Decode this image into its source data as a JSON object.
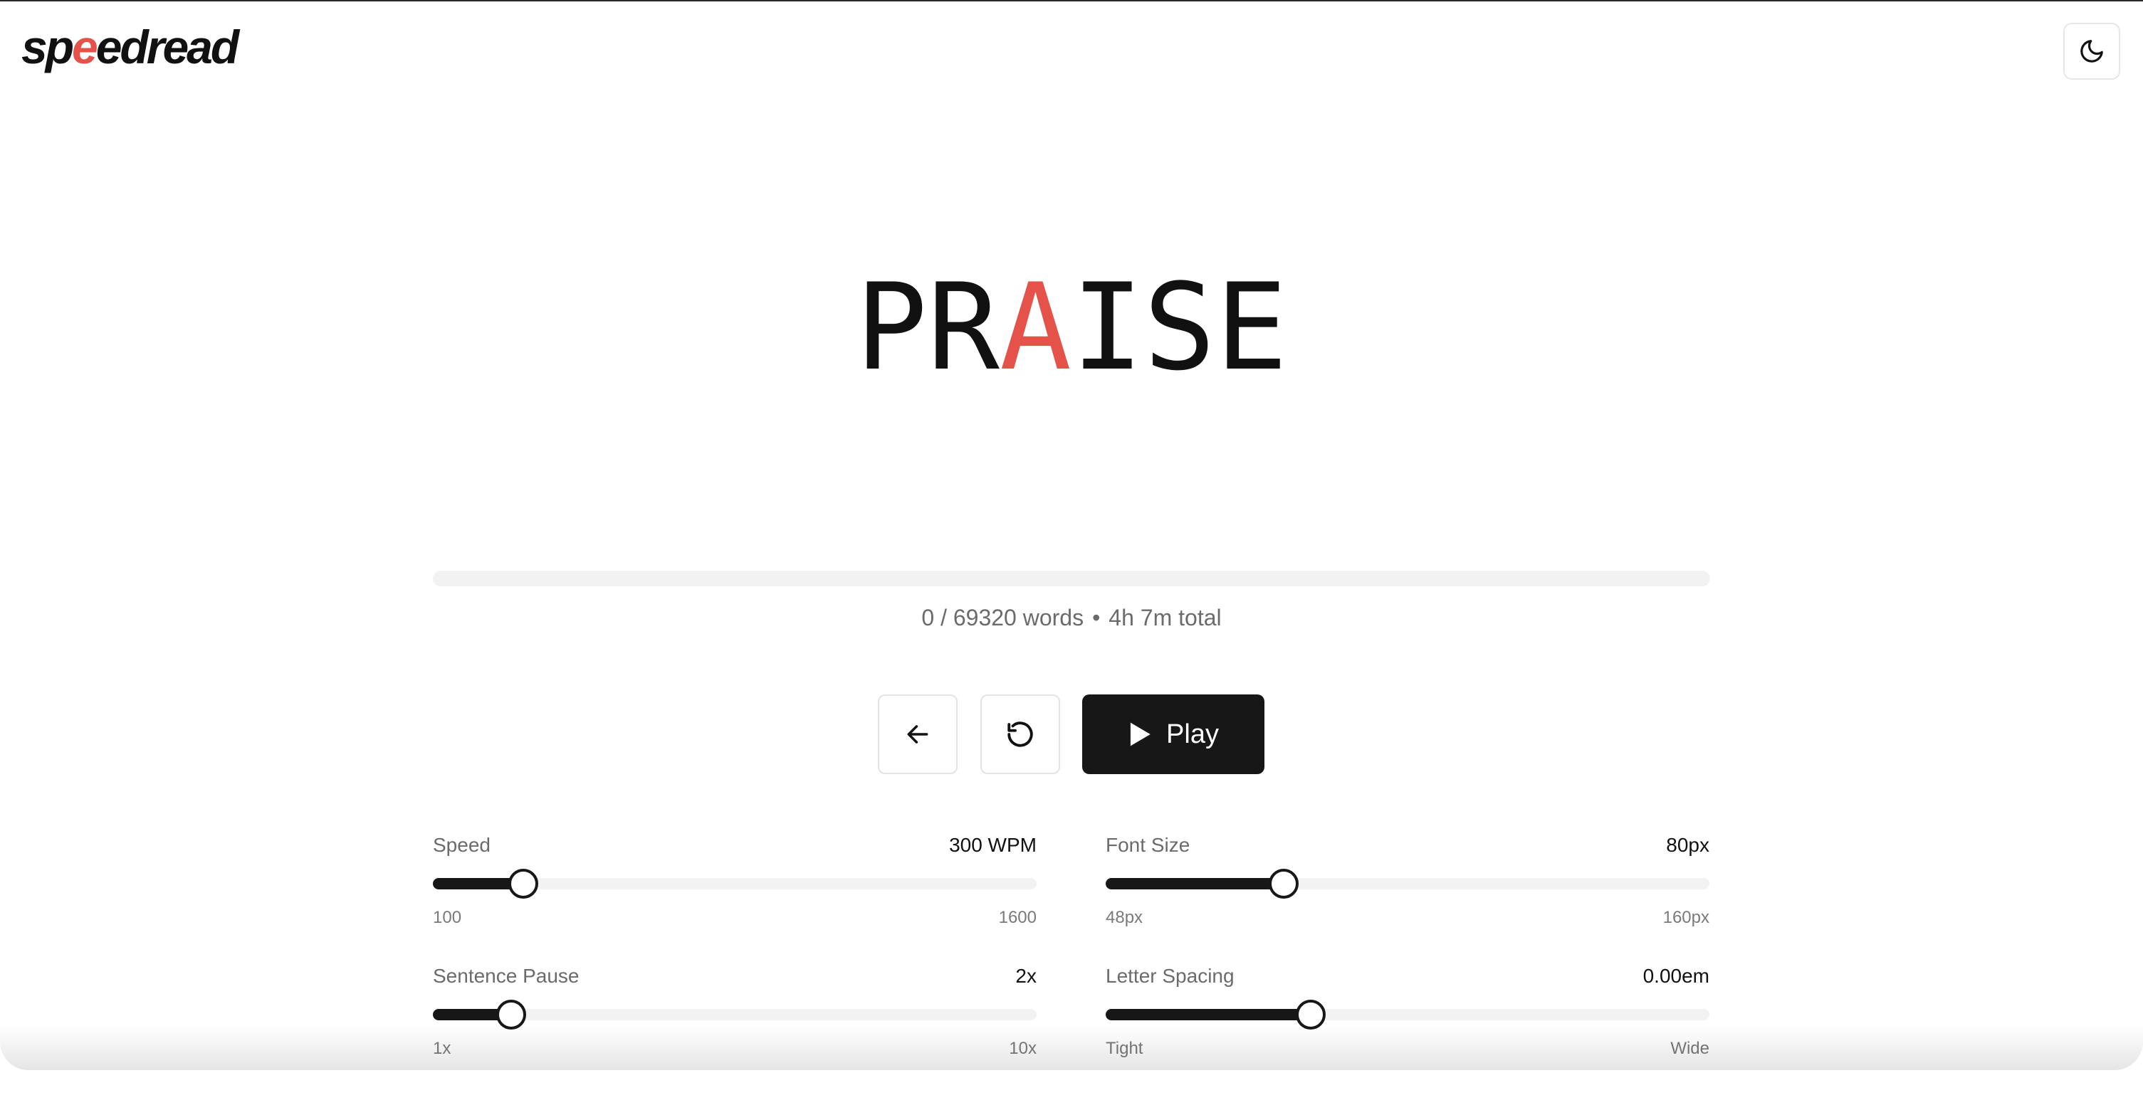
{
  "app": {
    "logo_part1": "sp",
    "logo_accent": "e",
    "logo_part2": "edread",
    "theme_toggle_icon": "moon-icon"
  },
  "reader": {
    "word_before": "PR",
    "word_focus": "A",
    "word_after": "ISE",
    "progress_fraction": 0,
    "words_progress": "0 / 69320 words",
    "separator": "•",
    "total_time": "4h 7m total"
  },
  "controls": {
    "back_icon": "arrow-left-icon",
    "restart_icon": "restart-icon",
    "play_icon": "play-icon",
    "play_label": "Play"
  },
  "settings": {
    "speed": {
      "label": "Speed",
      "value": "300 WPM",
      "min": "100",
      "max": "1600",
      "level": 0.15
    },
    "font_size": {
      "label": "Font Size",
      "value": "80px",
      "min": "48px",
      "max": "160px",
      "level": 0.295
    },
    "sentence_pause": {
      "label": "Sentence Pause",
      "value": "2x",
      "min": "1x",
      "max": "10x",
      "level": 0.13
    },
    "letter_spacing": {
      "label": "Letter Spacing",
      "value": "0.00em",
      "min": "Tight",
      "max": "Wide",
      "level": 0.34
    }
  },
  "colors": {
    "accent": "#e4524a",
    "primary": "#171717",
    "track": "#f2f2f2",
    "muted_text": "#6b6b6b"
  }
}
